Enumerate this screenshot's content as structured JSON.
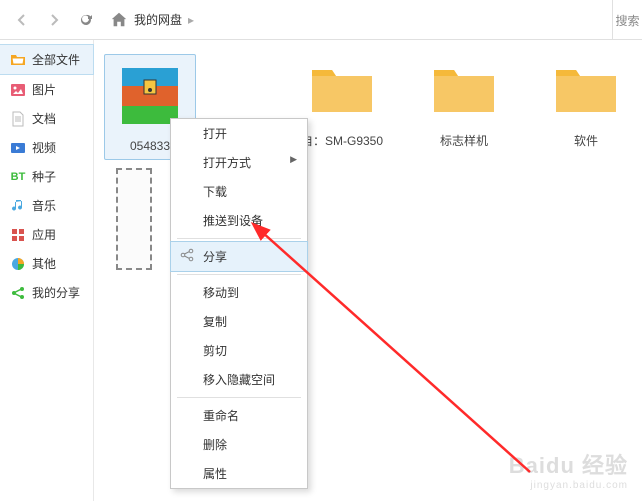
{
  "toolbar": {
    "breadcrumb_root": "我的网盘",
    "search_placeholder": "搜索"
  },
  "sidebar": {
    "items": [
      {
        "label": "全部文件"
      },
      {
        "label": "图片"
      },
      {
        "label": "文档"
      },
      {
        "label": "视频"
      },
      {
        "label": "种子"
      },
      {
        "label": "音乐"
      },
      {
        "label": "应用"
      },
      {
        "label": "其他"
      },
      {
        "label": "我的分享"
      }
    ]
  },
  "files": {
    "items": [
      {
        "label": "054833"
      },
      {
        "label": "自：SM-G9350"
      },
      {
        "label": "标志样机"
      },
      {
        "label": "软件"
      }
    ]
  },
  "context_menu": {
    "open": "打开",
    "open_with": "打开方式",
    "download": "下载",
    "push_to_device": "推送到设备",
    "share": "分享",
    "move_to": "移动到",
    "copy": "复制",
    "cut": "剪切",
    "move_to_hidden": "移入隐藏空间",
    "rename": "重命名",
    "delete": "删除",
    "properties": "属性"
  },
  "watermark": {
    "brand": "Baidu 经验",
    "sub": "jingyan.baidu.com"
  }
}
